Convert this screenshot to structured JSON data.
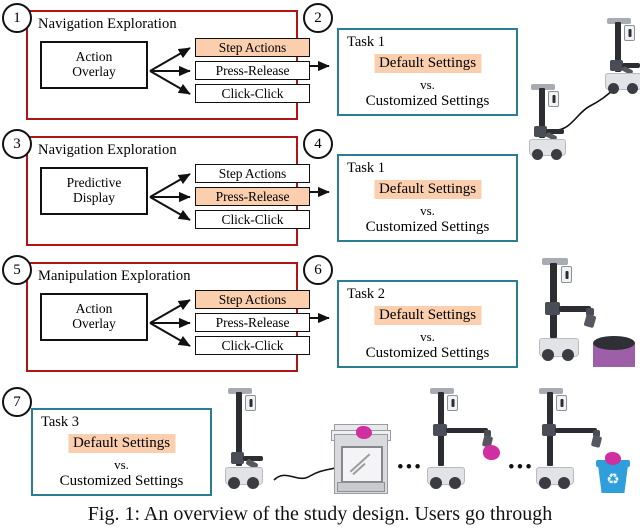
{
  "figure": {
    "caption": "Fig. 1: An overview of the study design. Users go through",
    "colors": {
      "exploration_border": "#b01515",
      "task_border": "#2a7d92",
      "highlight": "#fbcfae",
      "robot_dark": "#2b2d33",
      "robot_light": "#e2e3e6",
      "object_pink": "#cf2fa0",
      "cylinder_purple": "#9d5fa8",
      "bin_blue": "#2f9fdc"
    }
  },
  "steps": [
    {
      "number": "1"
    },
    {
      "number": "2"
    },
    {
      "number": "3"
    },
    {
      "number": "4"
    },
    {
      "number": "5"
    },
    {
      "number": "6"
    },
    {
      "number": "7"
    }
  ],
  "exploration_panels": [
    {
      "step": "1",
      "title": "Navigation Exploration",
      "source_line1": "Action",
      "source_line2": "Overlay",
      "options": [
        {
          "label": "Step Actions",
          "highlighted": true
        },
        {
          "label": "Press-Release",
          "highlighted": false
        },
        {
          "label": "Click-Click",
          "highlighted": false
        }
      ]
    },
    {
      "step": "3",
      "title": "Navigation Exploration",
      "source_line1": "Predictive",
      "source_line2": "Display",
      "options": [
        {
          "label": "Step Actions",
          "highlighted": false
        },
        {
          "label": "Press-Release",
          "highlighted": true
        },
        {
          "label": "Click-Click",
          "highlighted": false
        }
      ]
    },
    {
      "step": "5",
      "title": "Manipulation Exploration",
      "source_line1": "Action",
      "source_line2": "Overlay",
      "options": [
        {
          "label": "Step Actions",
          "highlighted": true
        },
        {
          "label": "Press-Release",
          "highlighted": false
        },
        {
          "label": "Click-Click",
          "highlighted": false
        }
      ]
    }
  ],
  "task_panels": [
    {
      "step": "2",
      "task": "Task 1",
      "default": "Default Settings",
      "vs": "vs.",
      "customized": "Customized Settings"
    },
    {
      "step": "4",
      "task": "Task 1",
      "default": "Default Settings",
      "vs": "vs.",
      "customized": "Customized Settings"
    },
    {
      "step": "6",
      "task": "Task 2",
      "default": "Default Settings",
      "vs": "vs.",
      "customized": "Customized Settings"
    },
    {
      "step": "7",
      "task": "Task 3",
      "default": "Default Settings",
      "vs": "vs.",
      "customized": "Customized Settings"
    }
  ],
  "illustrations": {
    "ellipsis_1": "•••",
    "ellipsis_2": "•••",
    "recycle_symbol": "♻",
    "scenes": [
      {
        "name": "navigation-robot-pair",
        "caption_free": true
      },
      {
        "name": "navigation-robot-pair-2",
        "caption_free": true
      },
      {
        "name": "manipulation-robot-with-cylinder",
        "caption_free": true
      },
      {
        "name": "task3-robot-to-stove-to-bin",
        "caption_free": true
      }
    ]
  }
}
